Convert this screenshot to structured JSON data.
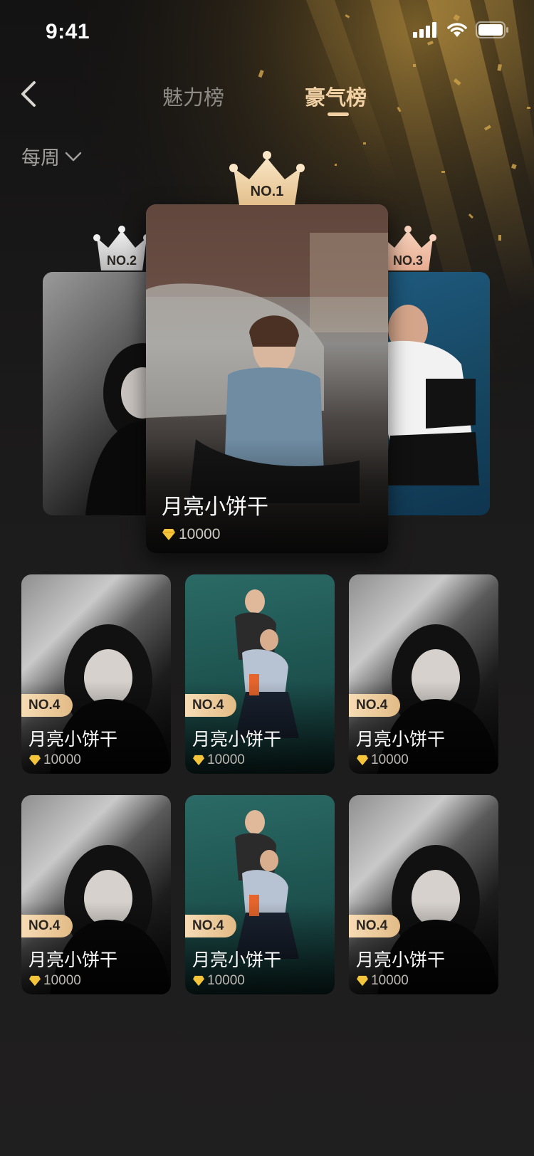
{
  "status": {
    "time": "9:41"
  },
  "nav": {
    "tabs": [
      {
        "label": "魅力榜",
        "active": false
      },
      {
        "label": "豪气榜",
        "active": true
      }
    ],
    "period": "每周"
  },
  "podium": [
    {
      "rank": "NO.1",
      "name": "月亮小饼干",
      "score": "10000"
    },
    {
      "rank": "NO.2"
    },
    {
      "rank": "NO.3"
    }
  ],
  "grid": [
    {
      "rank": "NO.4",
      "name": "月亮小饼干",
      "score": "10000",
      "tone": "bw"
    },
    {
      "rank": "NO.4",
      "name": "月亮小饼干",
      "score": "10000",
      "tone": "teal"
    },
    {
      "rank": "NO.4",
      "name": "月亮小饼干",
      "score": "10000",
      "tone": "bw"
    },
    {
      "rank": "NO.4",
      "name": "月亮小饼干",
      "score": "10000",
      "tone": "bw"
    },
    {
      "rank": "NO.4",
      "name": "月亮小饼干",
      "score": "10000",
      "tone": "teal"
    },
    {
      "rank": "NO.4",
      "name": "月亮小饼干",
      "score": "10000",
      "tone": "bw"
    }
  ],
  "colors": {
    "accent": "#f1d1a4",
    "gold": "#e2bb86",
    "background": "#1c1b1b"
  },
  "icons": {
    "back": "chevron-left-icon",
    "dropdown": "chevron-down-icon",
    "diamond": "diamond-icon",
    "crown": "crown-icon"
  }
}
